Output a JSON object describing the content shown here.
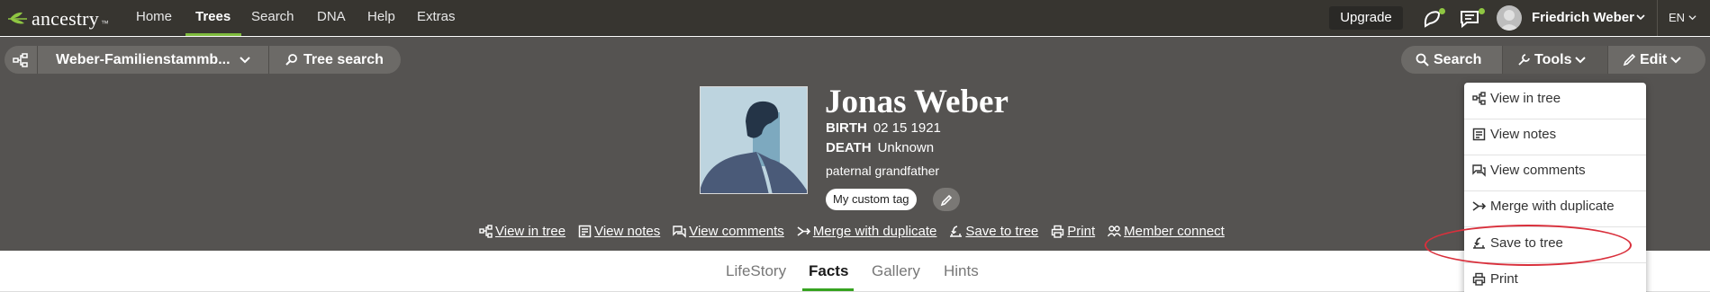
{
  "topnav": {
    "logo_text": "ancestry",
    "nav_items": [
      "Home",
      "Trees",
      "Search",
      "DNA",
      "Help",
      "Extras"
    ],
    "active_nav": "Trees",
    "upgrade_label": "Upgrade",
    "user_name": "Friedrich Weber",
    "language": "EN"
  },
  "toolbar": {
    "tree_name": "Weber-Familienstammb...",
    "tree_search_label": "Tree search",
    "search_label": "Search",
    "tools_label": "Tools",
    "edit_label": "Edit"
  },
  "person": {
    "name": "Jonas Weber",
    "birth_label": "BIRTH",
    "birth_value": "02 15 1921",
    "death_label": "DEATH",
    "death_value": "Unknown",
    "relation": "paternal grandfather",
    "tag": "My custom tag"
  },
  "actions": [
    {
      "label": "View in tree",
      "icon": "tree-icon"
    },
    {
      "label": "View notes",
      "icon": "notes-icon"
    },
    {
      "label": "View comments",
      "icon": "comments-icon"
    },
    {
      "label": "Merge with duplicate",
      "icon": "merge-icon"
    },
    {
      "label": "Save to tree",
      "icon": "save-to-tree-icon"
    },
    {
      "label": "Print",
      "icon": "print-icon"
    },
    {
      "label": "Member connect",
      "icon": "member-connect-icon"
    }
  ],
  "tabs": [
    "LifeStory",
    "Facts",
    "Gallery",
    "Hints"
  ],
  "active_tab": "Facts",
  "tools_menu": [
    {
      "label": "View in tree",
      "icon": "tree-icon"
    },
    {
      "label": "View notes",
      "icon": "notes-icon"
    },
    {
      "label": "View comments",
      "icon": "comments-icon"
    },
    {
      "label": "Merge with duplicate",
      "icon": "merge-icon"
    },
    {
      "label": "Save to tree",
      "icon": "save-to-tree-icon"
    },
    {
      "label": "Print",
      "icon": "print-icon"
    }
  ],
  "highlighted_menu_item": "Save to tree",
  "colors": {
    "nav_bg": "#373530",
    "header_bg": "#555351",
    "accent_green": "#7fbc3e",
    "tab_green": "#36a320",
    "highlight_red": "#d9303c"
  }
}
